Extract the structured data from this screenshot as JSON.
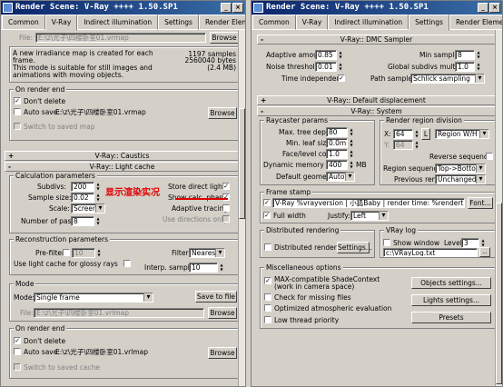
{
  "left": {
    "title": "Render Scene: V-Ray ++++ 1.50.SP1",
    "tabs": [
      "Common",
      "V-Ray",
      "Indirect illumination",
      "Settings",
      "Render Elements"
    ],
    "top": {
      "file_label": "File:",
      "file_value": "E:\\z\\光子\\四楼卧室01.vrmap",
      "browse": "Browse",
      "info_text": "A new irradiance map is created for each frame.\nThis mode is suitable for still images and animations with moving objects.",
      "samples": "1197 samples",
      "bytes": "2560040 bytes (2.4 MB)"
    },
    "render_end_1": {
      "title": "On render end",
      "dont_delete": "Don't delete",
      "auto_save": "Auto save:",
      "auto_save_value": "E:\\z\\光子\\四楼卧室01.vrmap",
      "browse": "Browse",
      "switch": "Switch to saved map"
    },
    "caustics_header": "V-Ray:: Caustics",
    "lightcache_header": "V-Ray:: Light cache",
    "calc": {
      "title": "Calculation parameters",
      "subdivs_label": "Subdivs:",
      "subdivs": "200",
      "sample_size_label": "Sample size:",
      "sample_size": "0.02",
      "scale_label": "Scale:",
      "scale": "Screen",
      "passes_label": "Number of passes:",
      "passes": "8",
      "store_direct": "Store direct light",
      "show_calc": "Show calc. phase",
      "adaptive": "Adaptive tracing",
      "use_directions": "Use directions only",
      "annotation": "显示渲染实况"
    },
    "recon": {
      "title": "Reconstruction parameters",
      "prefilter_label": "Pre-filter:",
      "prefilter": "10",
      "filter_label": "Filter:",
      "filter": "Nearest",
      "glossy": "Use light cache for glossy rays",
      "interp_label": "Interp. samples:",
      "interp": "10"
    },
    "mode": {
      "title": "Mode",
      "mode_label": "Mode:",
      "mode_value": "Single frame",
      "save_to_file": "Save to file",
      "file_label": "File:",
      "file_value": "E:\\z\\光子\\四楼卧室01.vrlmap",
      "browse": "Browse"
    },
    "render_end_2": {
      "title": "On render end",
      "dont_delete": "Don't delete",
      "auto_save": "Auto save:",
      "auto_save_value": "E:\\z\\光子\\四楼卧室01.vrlmap",
      "browse": "Browse",
      "switch": "Switch to saved cache"
    }
  },
  "right": {
    "title": "Render Scene: V-Ray ++++ 1.50.SP1",
    "tabs": [
      "Common",
      "V-Ray",
      "Indirect illumination",
      "Settings",
      "Render Elements"
    ],
    "dmc_header": "V-Ray:: DMC Sampler",
    "dmc": {
      "adaptive_amount_label": "Adaptive amount:",
      "adaptive_amount": "0.85",
      "noise_label": "Noise threshold:",
      "noise": "0.01",
      "time_independent": "Time independent",
      "min_samples_label": "Min samples:",
      "min_samples": "8",
      "global_subdivs_label": "Global subdivs multiplier:",
      "global_subdivs": "1.0",
      "path_sampler_label": "Path sampler:",
      "path_sampler": "Schlick sampling"
    },
    "displacement_header": "V-Ray:: Default displacement",
    "system_header": "V-Ray:: System",
    "raycaster": {
      "title": "Raycaster params",
      "max_depth_label": "Max. tree depth:",
      "max_depth": "80",
      "min_leaf_label": "Min. leaf size:",
      "min_leaf": "0.0mm",
      "face_coef_label": "Face/level coef.",
      "face_coef": "1.0",
      "dyn_mem_label": "Dynamic memory limit:",
      "dyn_mem": "400",
      "dyn_mem_unit": "MB",
      "geometry_label": "Default geometry:",
      "geometry": "Auto"
    },
    "region": {
      "title": "Render region division",
      "x_label": "X:",
      "x": "64",
      "y_label": "Y:",
      "y": "64",
      "lock": "L",
      "unit": "Region W/H",
      "reverse": "Reverse sequence",
      "seq_label": "Region sequence:",
      "seq": "Top->Bottom",
      "prev_label": "Previous render:",
      "prev": "Unchanged"
    },
    "frame_stamp": {
      "title": "Frame stamp",
      "text": "V-Ray %vrayversion | 小狐Baby | render time: %rendertime",
      "font": "Font...",
      "full_width": "Full width",
      "justify_label": "Justify:",
      "justify": "Left"
    },
    "distributed": {
      "title": "Distributed rendering",
      "label": "Distributed rendering",
      "settings": "Settings..."
    },
    "vraylog": {
      "title": "VRay log",
      "show_window": "Show window",
      "level_label": "Level:",
      "level": "3",
      "path": "c:\\VRayLog.txt"
    },
    "misc": {
      "title": "Miscellaneous options",
      "max_compat": "MAX-compatible ShadeContext\n(work in camera space)",
      "check_missing": "Check for missing files",
      "optimized_atm": "Optimized atmospheric evaluation",
      "low_thread": "Low thread priority",
      "objects_settings": "Objects settings...",
      "lights_settings": "Lights settings...",
      "presets": "Presets"
    }
  },
  "colors": {
    "title_start": "#0a246a",
    "title_end": "#3a6ea5",
    "annotation": "#e00000"
  }
}
